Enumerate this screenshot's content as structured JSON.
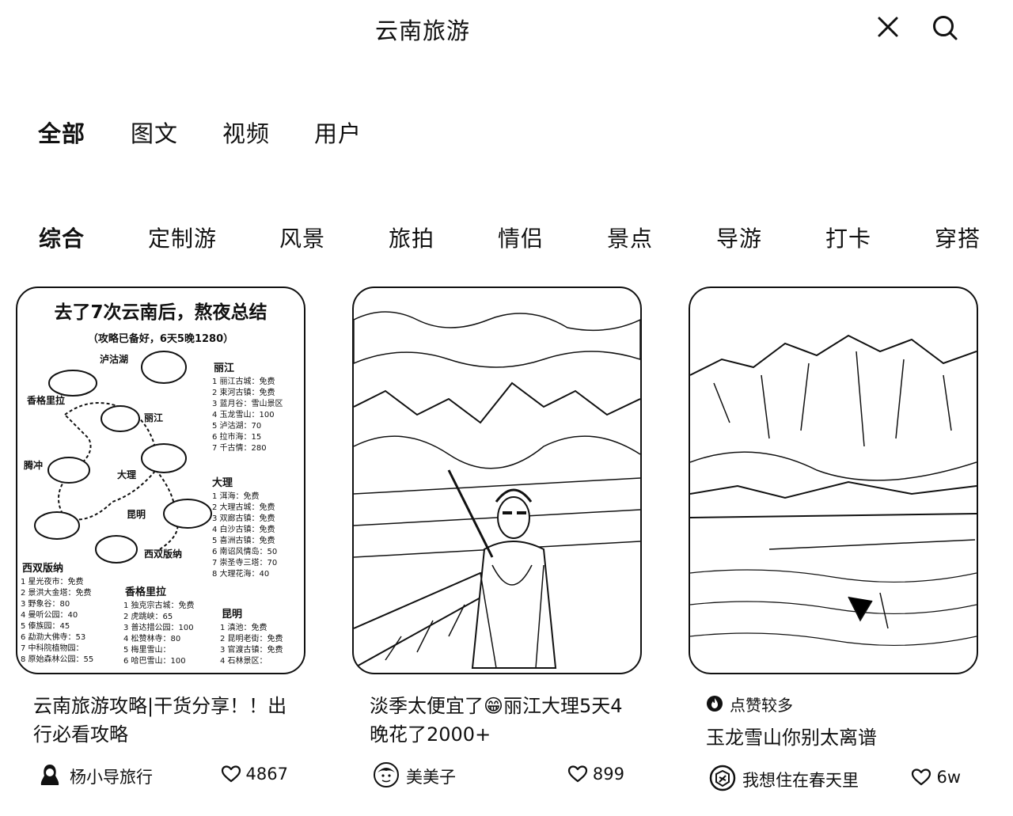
{
  "header": {
    "title": "云南旅游",
    "close_icon": "close-icon",
    "search_icon": "search-icon"
  },
  "tabs": [
    {
      "label": "全部",
      "active": true
    },
    {
      "label": "图文",
      "active": false
    },
    {
      "label": "视频",
      "active": false
    },
    {
      "label": "用户",
      "active": false
    }
  ],
  "categories": [
    {
      "label": "综合",
      "active": true
    },
    {
      "label": "定制游",
      "active": false
    },
    {
      "label": "风景",
      "active": false
    },
    {
      "label": "旅拍",
      "active": false
    },
    {
      "label": "情侣",
      "active": false
    },
    {
      "label": "景点",
      "active": false
    },
    {
      "label": "导游",
      "active": false
    },
    {
      "label": "打卡",
      "active": false
    },
    {
      "label": "穿搭",
      "active": false
    }
  ],
  "cards": [
    {
      "image": {
        "heading": "去了7次云南后，熬夜总结",
        "subheading": "（攻略已备好，6天5晚1280）",
        "places": [
          "泸沽湖",
          "香格里拉",
          "丽江",
          "腾冲",
          "大理",
          "昆明",
          "西双版纳"
        ],
        "lists": [
          {
            "name": "丽江",
            "items": [
              "1 丽江古城：免费",
              "2 束河古镇：免费",
              "3 蓝月谷：雪山景区",
              "4 玉龙雪山：100",
              "5 泸沽湖：70",
              "6 拉市海：15",
              "7 千古情：280"
            ]
          },
          {
            "name": "大理",
            "items": [
              "1 洱海：免费",
              "2 大理古城：免费",
              "3 双廊古镇：免费",
              "4 白沙古镇：免费",
              "5 喜洲古镇：免费",
              "6 南诏风情岛：50",
              "7 崇圣寺三塔：70",
              "8 大理花海：40"
            ]
          },
          {
            "name": "西双版纳",
            "items": [
              "1 星光夜市：免费",
              "2 景洪大金塔：免费",
              "3 野象谷：80",
              "4 曼听公园：40",
              "5 傣族园：45",
              "6 勐泐大佛寺：53",
              "7 中科院植物园：",
              "8 原始森林公园：55"
            ]
          },
          {
            "name": "香格里拉",
            "items": [
              "1 独克宗古城：免费",
              "2 虎跳峡：65",
              "3 普达措公园：100",
              "4 松赞林寺：80",
              "5 梅里雪山：",
              "6 哈巴雪山：100"
            ]
          },
          {
            "name": "昆明",
            "items": [
              "1 滇池：免费",
              "2 昆明老街：免费",
              "3 官渡古镇：免费",
              "4 石林景区："
            ]
          }
        ]
      },
      "title": "云南旅游攻略|干货分享！！出行必看攻略",
      "badge": "",
      "author": "杨小导旅行",
      "likes": "4867"
    },
    {
      "title": "淡季太便宜了😁丽江大理5天4晚花了2000+",
      "badge": "",
      "author": "美美子",
      "likes": "899"
    },
    {
      "title": "玉龙雪山你别太离谱",
      "badge": "点赞较多",
      "author": "我想住在春天里",
      "likes": "6w"
    }
  ]
}
